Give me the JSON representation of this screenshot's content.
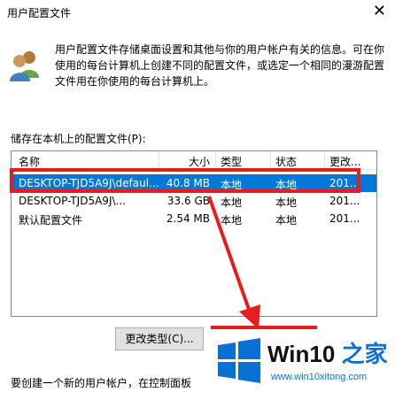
{
  "window": {
    "title": "用户配置文件",
    "close_glyph": "✕"
  },
  "description": "用户配置文件存储桌面设置和其他与你的用户帐户有关的信息。可在你使用的每台计算机上创建不同的配置文件，或选定一个相同的漫游配置文件用在你使用的每台计算机上。",
  "list": {
    "label": "储存在本机上的配置文件(P):",
    "columns": {
      "name": "名称",
      "size": "大小",
      "type": "类型",
      "status": "状态",
      "modified": "更改..."
    },
    "rows": [
      {
        "name": "DESKTOP-TJD5A9J\\defaul...",
        "size": "40.8 MB",
        "type": "本地",
        "status": "本地",
        "modified": "201..."
      },
      {
        "name": "DESKTOP-TJD5A9J\\...",
        "size": "33.6 GB",
        "type": "本地",
        "status": "本地",
        "modified": "201..."
      },
      {
        "name": "默认配置文件",
        "size": "2.54 MB",
        "type": "本地",
        "status": "本地",
        "modified": "201..."
      }
    ]
  },
  "buttons": {
    "change_type": "更改类型(C)..."
  },
  "bottom_note": "要创建一个新的用户帐户，在控制面板",
  "watermark": {
    "brand_prefix": "Win10 ",
    "brand_suffix": "之家",
    "url": "www.win10xitong.com"
  },
  "colors": {
    "selection": "#0078d7",
    "annotation": "#e81c1c",
    "brand": "#0a71d4"
  }
}
